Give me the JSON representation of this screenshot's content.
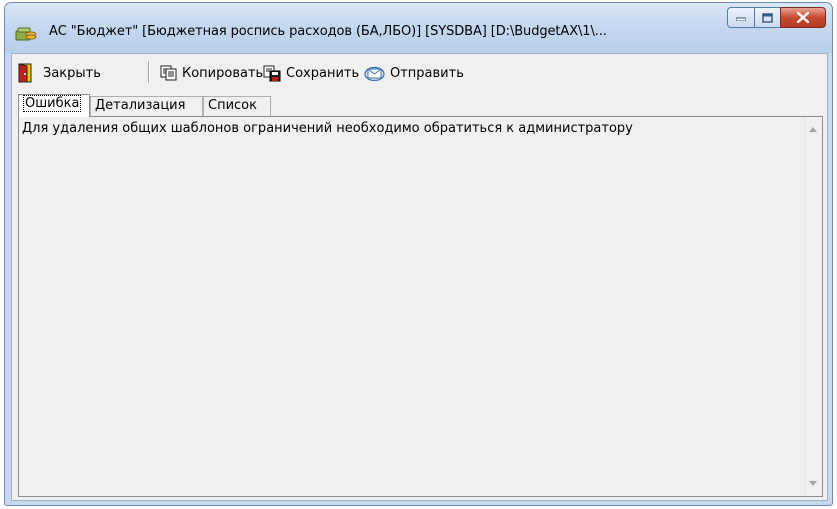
{
  "window": {
    "title": "АС \"Бюджет\" [Бюджетная роспись расходов (БА,ЛБО)] [SYSDBA] [D:\\BudgetAX\\1\\...",
    "icon": "budget-app-icon",
    "minimize_icon": "minimize-icon",
    "maximize_icon": "maximize-icon",
    "close_icon": "close-icon"
  },
  "toolbar": {
    "close_label": "Закрыть",
    "copy_label": "Копировать",
    "save_label": "Сохранить",
    "send_label": "Отправить"
  },
  "tabs": [
    {
      "label": "Ошибка",
      "active": true
    },
    {
      "label": "Детализация",
      "active": false
    },
    {
      "label": "Список",
      "active": false
    }
  ],
  "error": {
    "message": "Для удаления общих шаблонов ограничений необходимо обратиться к администратору"
  },
  "colors": {
    "titlebar": "#c4d8ef",
    "close_button": "#c74a33",
    "client_bg": "#f0f0f0"
  }
}
